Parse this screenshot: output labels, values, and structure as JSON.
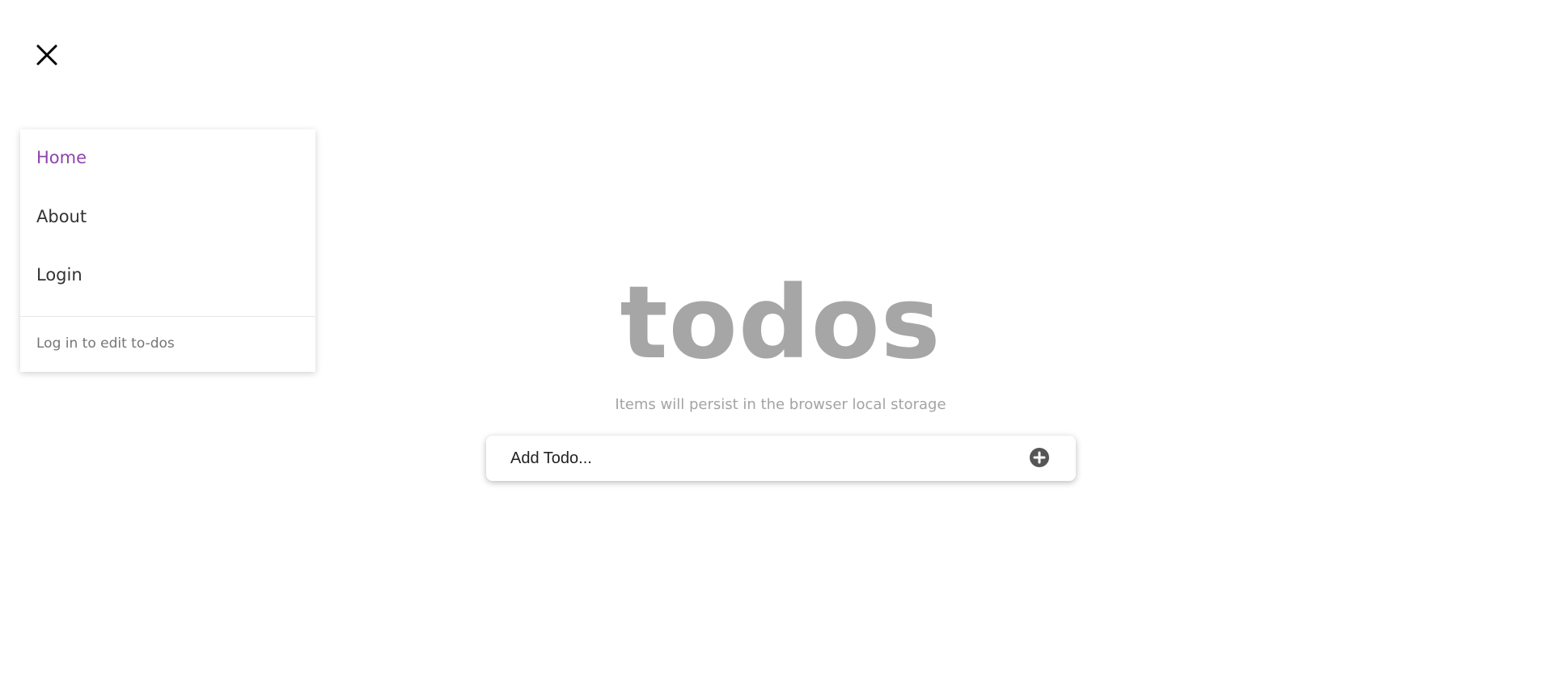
{
  "colors": {
    "accent": "#8e44ad",
    "title": "#a6a6a6",
    "subtitle": "#a3a3a3",
    "add_icon": "#555555"
  },
  "icons": {
    "close": "close-icon",
    "add": "plus-circle-icon"
  },
  "menu": {
    "items": [
      {
        "label": "Home",
        "active": true
      },
      {
        "label": "About",
        "active": false
      },
      {
        "label": "Login",
        "active": false
      }
    ],
    "footer": "Log in to edit to-dos"
  },
  "main": {
    "title": "todos",
    "subtitle": "Items will persist in the browser local storage",
    "input_placeholder": "Add Todo..."
  }
}
